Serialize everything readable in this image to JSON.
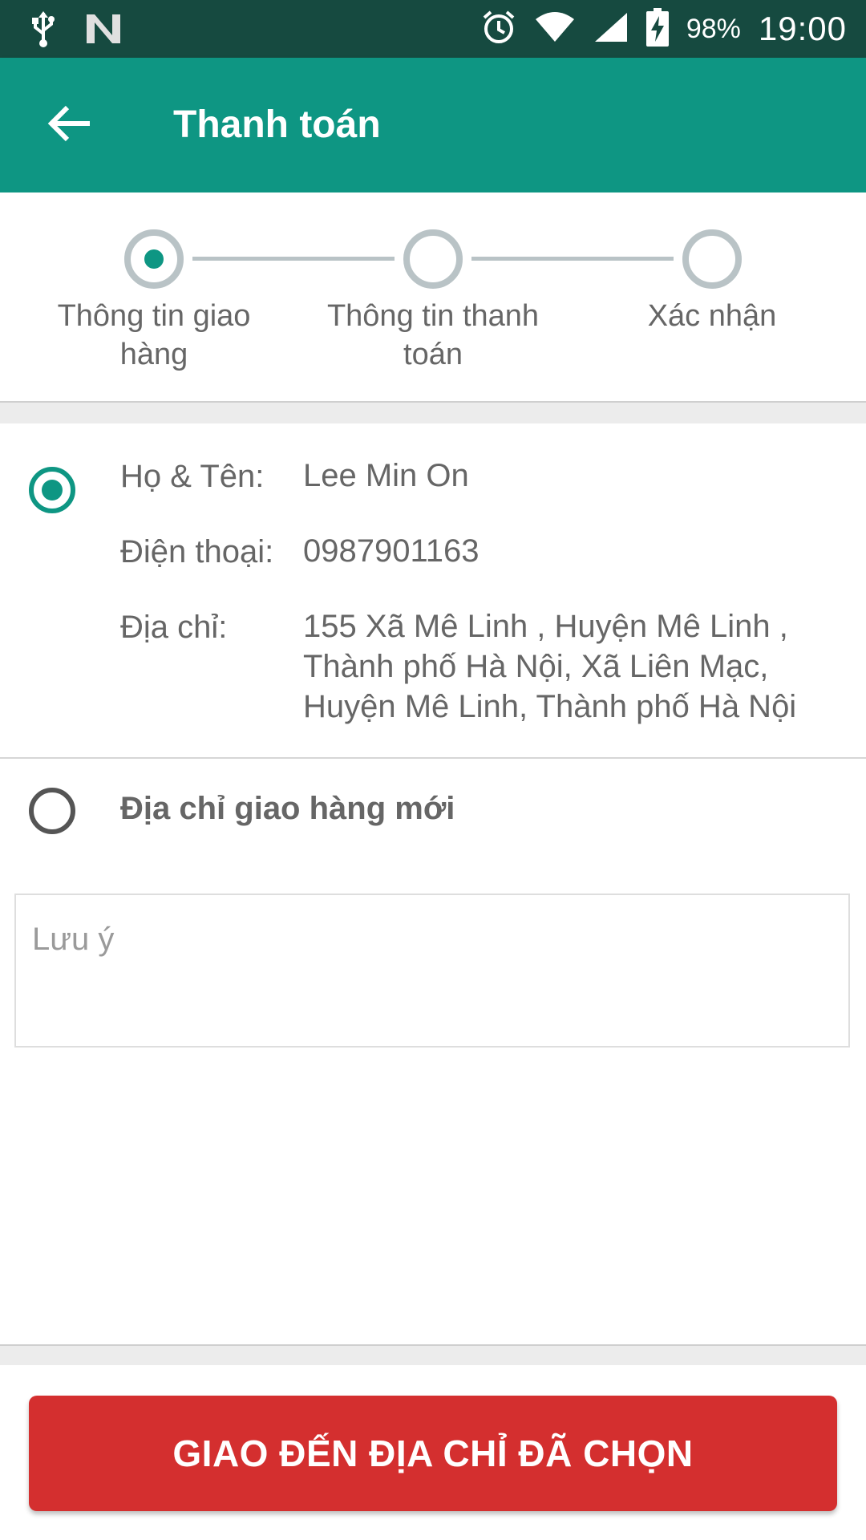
{
  "status_bar": {
    "battery_percent": "98%",
    "time": "19:00",
    "icons": [
      "usb-icon",
      "n-icon",
      "alarm-icon",
      "wifi-icon",
      "cell-signal-icon",
      "battery-charging-icon"
    ]
  },
  "toolbar": {
    "title": "Thanh toán",
    "back_icon": "arrow-left-icon",
    "color": "#0e9683"
  },
  "stepper": {
    "steps": [
      {
        "label": "Thông tin giao hàng",
        "active": true
      },
      {
        "label": "Thông tin thanh toán",
        "active": false
      },
      {
        "label": "Xác nhận",
        "active": false
      }
    ]
  },
  "address": {
    "name_label": "Họ & Tên:",
    "name_value": "Lee Min On",
    "phone_label": "Điện thoại:",
    "phone_value": "0987901163",
    "address_label": "Địa chỉ:",
    "address_value": "155 Xã Mê Linh , Huyện Mê Linh , Thành phố Hà Nội, Xã Liên Mạc, Huyện Mê Linh, Thành phố Hà Nội",
    "selected": true
  },
  "new_address": {
    "label": "Địa chỉ giao hàng mới",
    "selected": false
  },
  "note": {
    "placeholder": "Lưu ý",
    "value": ""
  },
  "cta": {
    "label": "GIAO ĐẾN ĐỊA CHỈ ĐÃ CHỌN",
    "color": "#d42f2f"
  }
}
